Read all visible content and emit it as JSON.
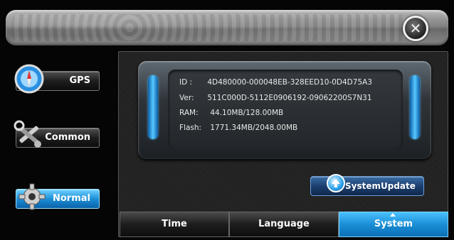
{
  "window": {
    "close_icon": "close-icon"
  },
  "sidebar": {
    "items": [
      {
        "label": "GPS",
        "icon": "compass-icon",
        "active": false
      },
      {
        "label": "Common",
        "icon": "tools-icon",
        "active": false
      },
      {
        "label": "Normal",
        "icon": "gear-icon",
        "active": true
      }
    ]
  },
  "info": {
    "id_label": "ID :",
    "id_value": "4D480000-000048EB-328EED10-0D4D75A3",
    "ver_label": "Ver:",
    "ver_value": "511C000D-5112E0906192-09062200S7N31",
    "ram_label": "RAM:",
    "ram_value": "44.10MB/128.00MB",
    "flash_label": "Flash:",
    "flash_value": "1771.34MB/2048.00MB"
  },
  "actions": {
    "system_update_label": "SystemUpdate",
    "system_update_icon": "upload-arrow-icon"
  },
  "tabs": [
    {
      "label": "Time",
      "active": false
    },
    {
      "label": "Language",
      "active": false
    },
    {
      "label": "System",
      "active": true
    }
  ],
  "colors": {
    "accent": "#1b8fd6",
    "background": "#050505",
    "text": "#ffffff"
  }
}
